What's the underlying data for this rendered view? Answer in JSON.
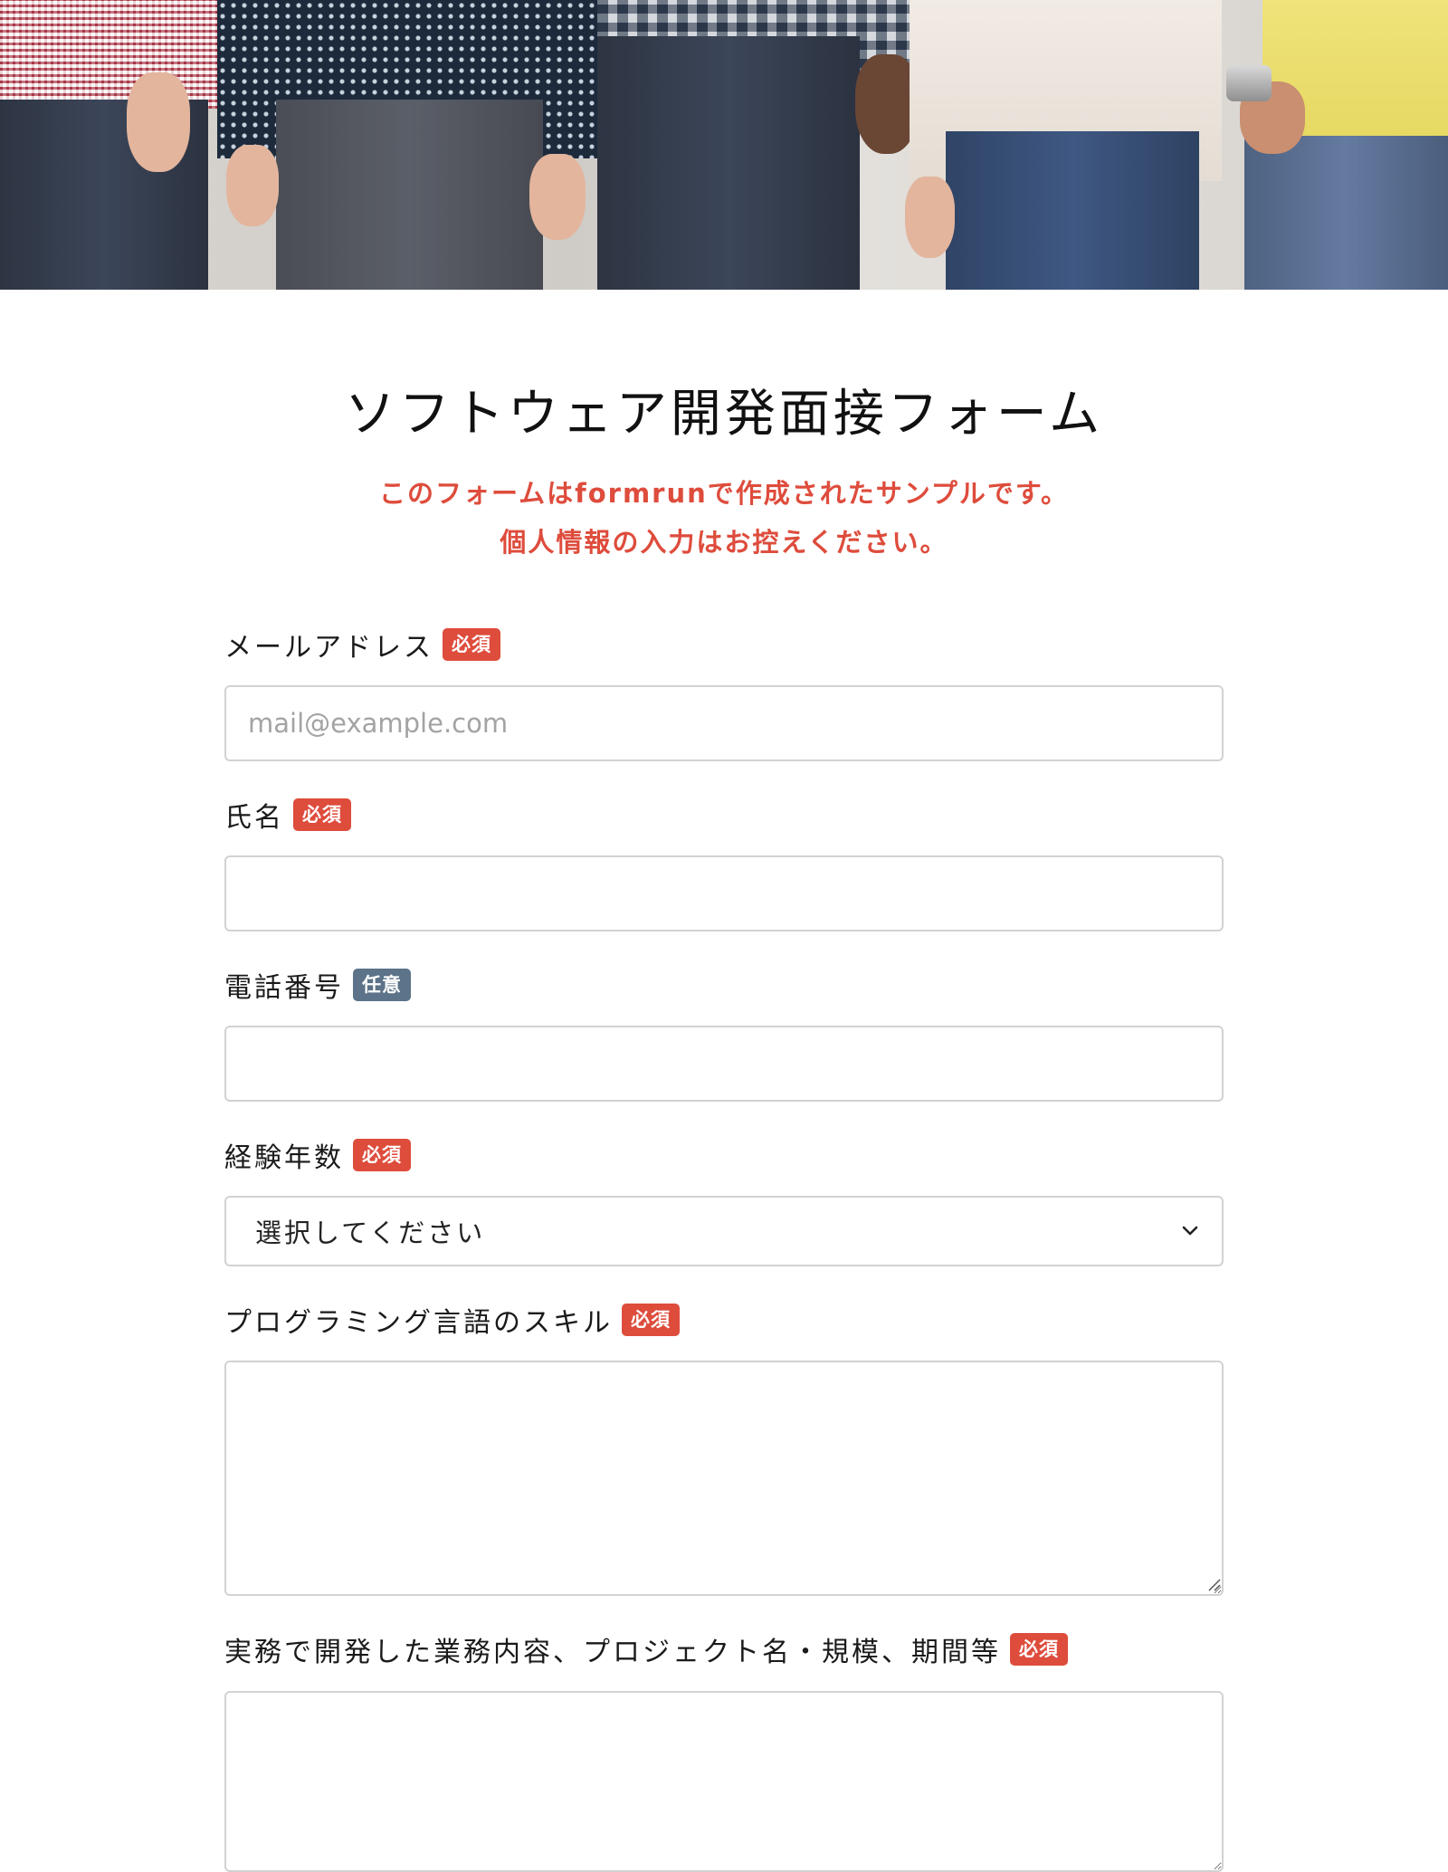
{
  "hero": {
    "image": "people-in-casual-clothes-photo"
  },
  "form": {
    "title": "ソフトウェア開発面接フォーム",
    "notice_line1": "このフォームはformrunで作成されたサンプルです。",
    "notice_line2": "個人情報の入力はお控えください。",
    "fields": {
      "email": {
        "label": "メールアドレス",
        "badge": "必須",
        "placeholder": "mail@example.com",
        "value": ""
      },
      "name": {
        "label": "氏名",
        "badge": "必須",
        "value": ""
      },
      "phone": {
        "label": "電話番号",
        "badge": "任意",
        "value": ""
      },
      "experience": {
        "label": "経験年数",
        "badge": "必須",
        "selected": "選択してください"
      },
      "skills": {
        "label": "プログラミング言語のスキル",
        "badge": "必須",
        "value": ""
      },
      "projects": {
        "label": "実務で開発した業務内容、プロジェクト名・規模、期間等",
        "badge": "必須",
        "value": ""
      }
    }
  },
  "colors": {
    "required_badge": "#de4c3c",
    "optional_badge": "#5c7389",
    "notice_text": "#de4c3c",
    "input_border": "#d2d2d2"
  }
}
